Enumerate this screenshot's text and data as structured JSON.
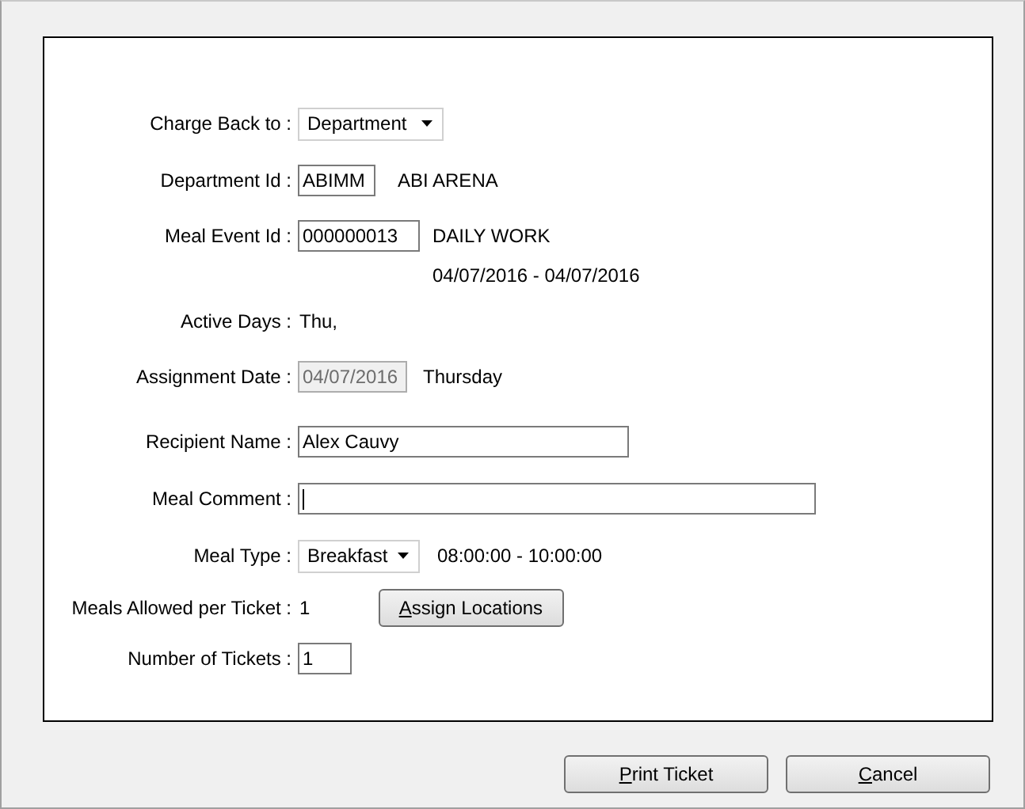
{
  "form_rows": [
    {
      "kind": "select",
      "label": "Charge Back to :",
      "value": "Department"
    },
    {
      "kind": "field",
      "label": "Department Id :",
      "value": "ABIMM",
      "note": "ABI ARENA",
      "disabled": false
    },
    {
      "kind": "field",
      "label": "Meal Event Id :",
      "value": "000000013",
      "note": "DAILY WORK",
      "disabled": false
    },
    {
      "kind": "note",
      "note": "04/07/2016 - 04/07/2016"
    },
    {
      "kind": "text",
      "label": "Active Days :",
      "value": "Thu,"
    },
    {
      "kind": "field",
      "label": "Assignment Date :",
      "value": "04/07/2016",
      "note": "Thursday",
      "disabled": true
    },
    {
      "kind": "field",
      "label": "Recipient Name :",
      "value": "Alex Cauvy",
      "disabled": false
    },
    {
      "kind": "field",
      "label": "Meal Comment :",
      "value": "",
      "focused": true,
      "disabled": false
    },
    {
      "kind": "select",
      "label": "Meal Type :",
      "value": "Breakfast",
      "note": "08:00:00 - 10:00:00"
    },
    {
      "kind": "text",
      "label": "Meals Allowed per Ticket :",
      "value": "1",
      "button": "Assign Locations"
    },
    {
      "kind": "field",
      "label": "Number of Tickets :",
      "value": "1",
      "disabled": false
    }
  ],
  "buttons": [
    "Print Ticket",
    "Cancel"
  ]
}
